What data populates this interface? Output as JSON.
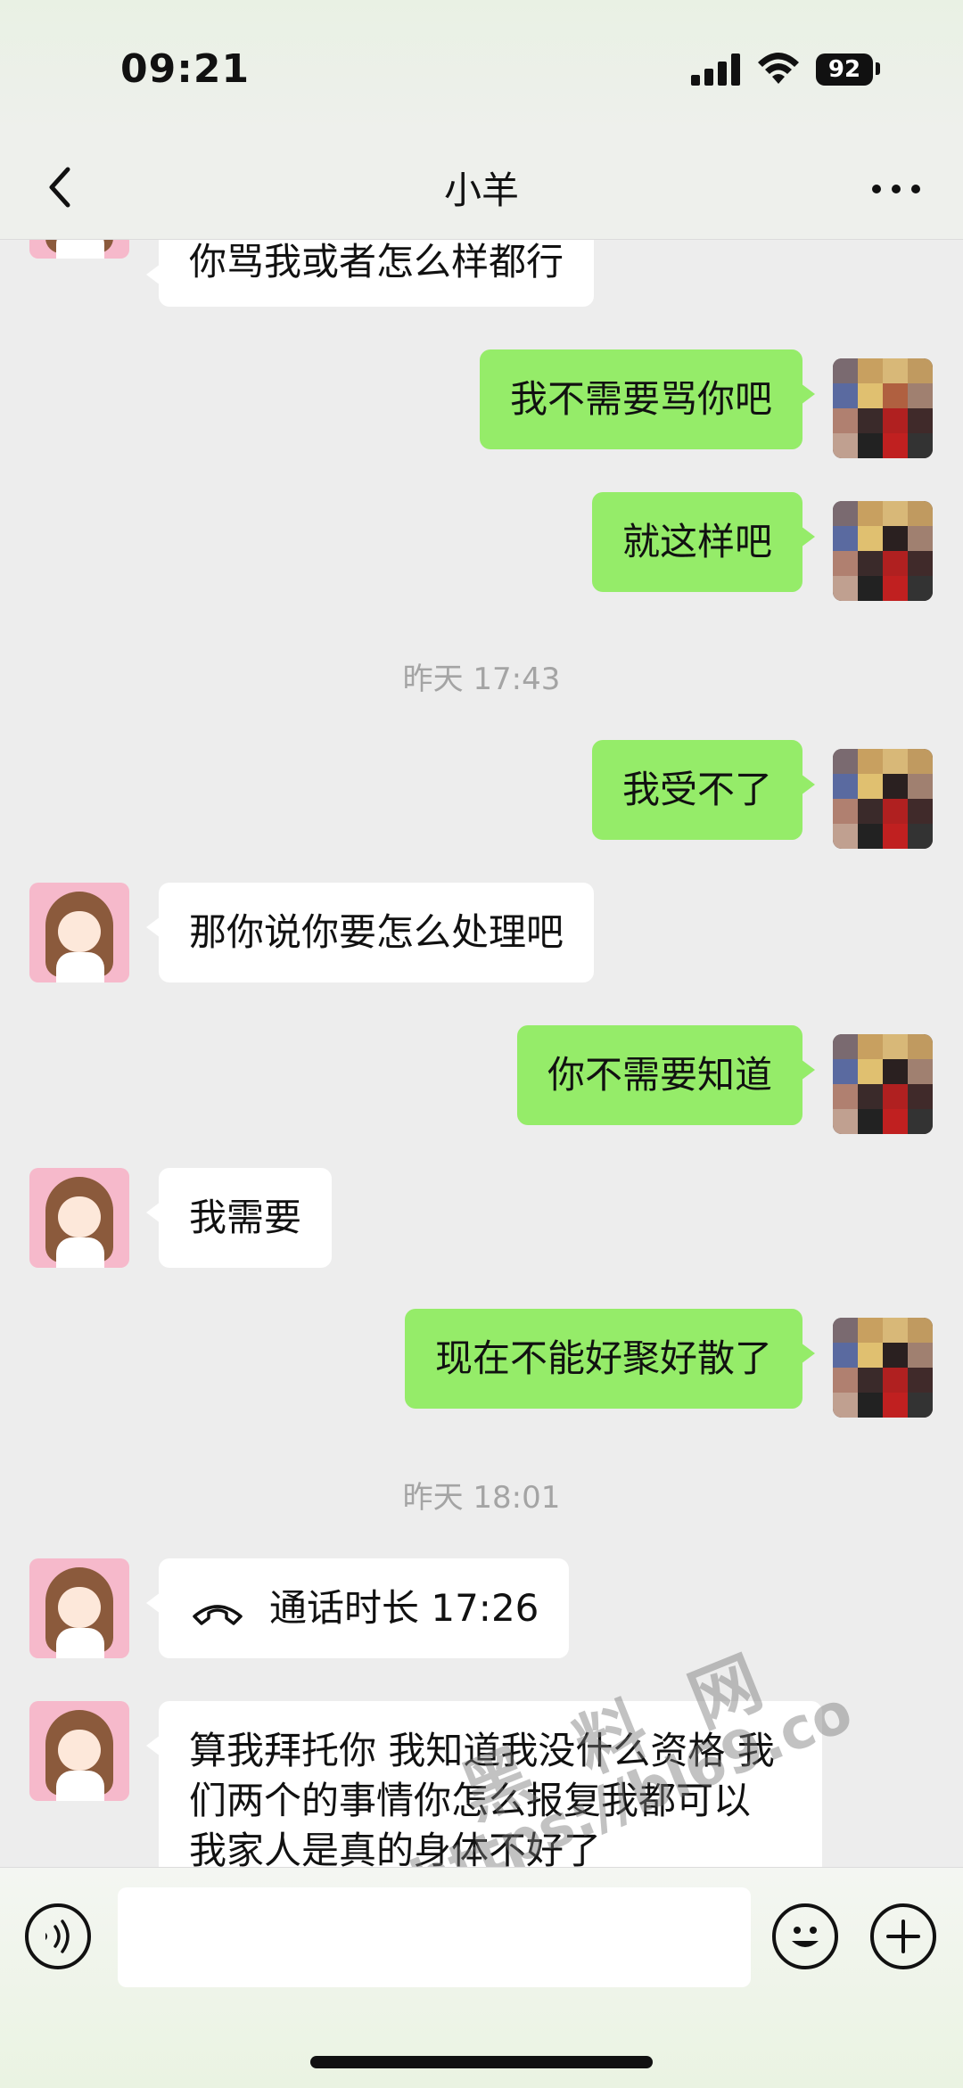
{
  "status_bar": {
    "time": "09:21",
    "battery": "92"
  },
  "header": {
    "title": "小羊"
  },
  "messages": [
    {
      "side": "in",
      "text": "你骂我或者怎么样都行"
    },
    {
      "side": "out",
      "text": "我不需要骂你吧"
    },
    {
      "side": "out",
      "text": "就这样吧"
    },
    {
      "side": "time",
      "text": "昨天 17:43"
    },
    {
      "side": "out",
      "text": "我受不了"
    },
    {
      "side": "in",
      "text": "那你说你要怎么处理吧"
    },
    {
      "side": "out",
      "text": "你不需要知道"
    },
    {
      "side": "in",
      "text": "我需要"
    },
    {
      "side": "out",
      "text": "现在不能好聚好散了"
    },
    {
      "side": "time",
      "text": "昨天 18:01"
    },
    {
      "side": "in",
      "type": "call",
      "text": "通话时长 17:26"
    },
    {
      "side": "in",
      "text": "算我拜托你 我知道我没什么资格 我们两个的事情你怎么报复我都可以 我家人是真的身体不好了"
    }
  ],
  "watermark": {
    "line1": "黑料网",
    "line2": "https://bl69.co"
  },
  "icons": {
    "back": "chevron-left-icon",
    "more": "more-dots-icon",
    "voice": "voice-icon",
    "emoji": "emoji-icon",
    "plus": "plus-icon",
    "call": "phone-hangup-icon"
  },
  "colors": {
    "bubble_out": "#95ec69",
    "bubble_in": "#ffffff",
    "background": "#ededed"
  }
}
